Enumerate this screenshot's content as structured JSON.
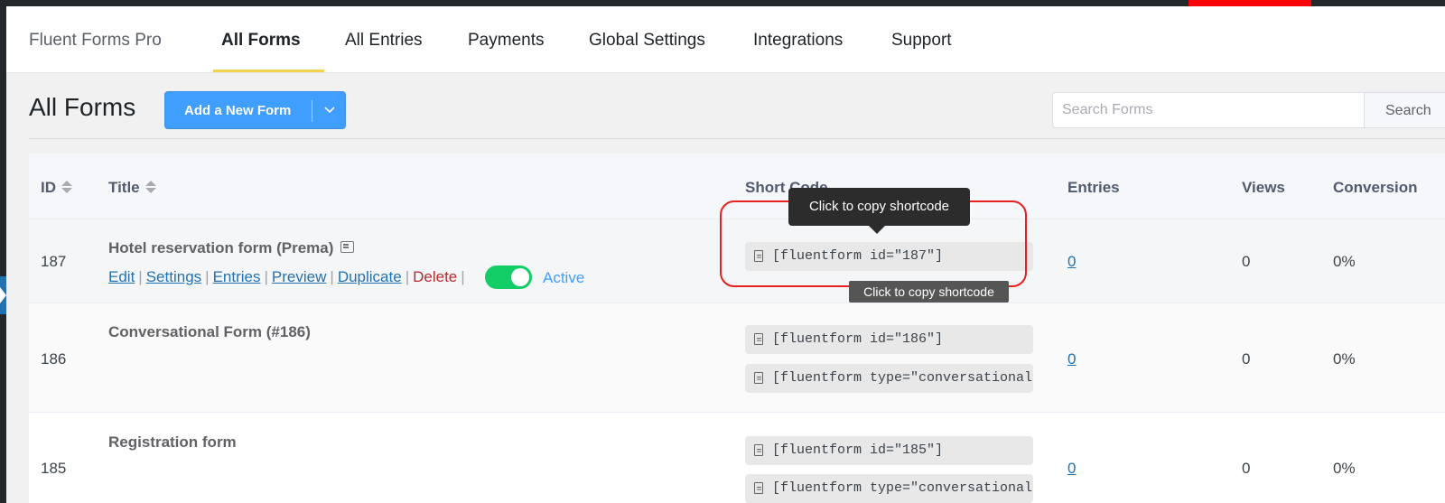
{
  "nav": {
    "brand": "Fluent Forms Pro",
    "items": [
      "All Forms",
      "All Entries",
      "Payments",
      "Global Settings",
      "Integrations",
      "Support"
    ]
  },
  "header": {
    "title": "All Forms",
    "add_button": "Add a New Form",
    "search_placeholder": "Search Forms",
    "search_button": "Search"
  },
  "table": {
    "columns": [
      "ID",
      "Title",
      "Short Code",
      "Entries",
      "Views",
      "Conversion"
    ],
    "rows": [
      {
        "id": "187",
        "title": "Hotel reservation form (Prema)",
        "shortcodes": [
          "[fluentform id=\"187\"]"
        ],
        "entries": "0",
        "views": "0",
        "conversion": "0%"
      },
      {
        "id": "186",
        "title": "Conversational Form (#186)",
        "shortcodes": [
          "[fluentform id=\"186\"]",
          "[fluentform type=\"conversational\""
        ],
        "entries": "0",
        "views": "0",
        "conversion": "0%"
      },
      {
        "id": "185",
        "title": "Registration form",
        "shortcodes": [
          "[fluentform id=\"185\"]",
          "[fluentform type=\"conversational\""
        ],
        "entries": "0",
        "views": "0",
        "conversion": "0%"
      }
    ],
    "row_actions": [
      "Edit",
      "Settings",
      "Entries",
      "Preview",
      "Duplicate",
      "Delete"
    ],
    "status_label": "Active"
  },
  "tooltips": {
    "primary": "Click to copy shortcode",
    "secondary": "Click to copy shortcode"
  },
  "colors": {
    "accent": "#409eff",
    "toggle_on": "#13ce66",
    "highlight": "#e8201f",
    "nav_underline": "#f4d24b"
  }
}
